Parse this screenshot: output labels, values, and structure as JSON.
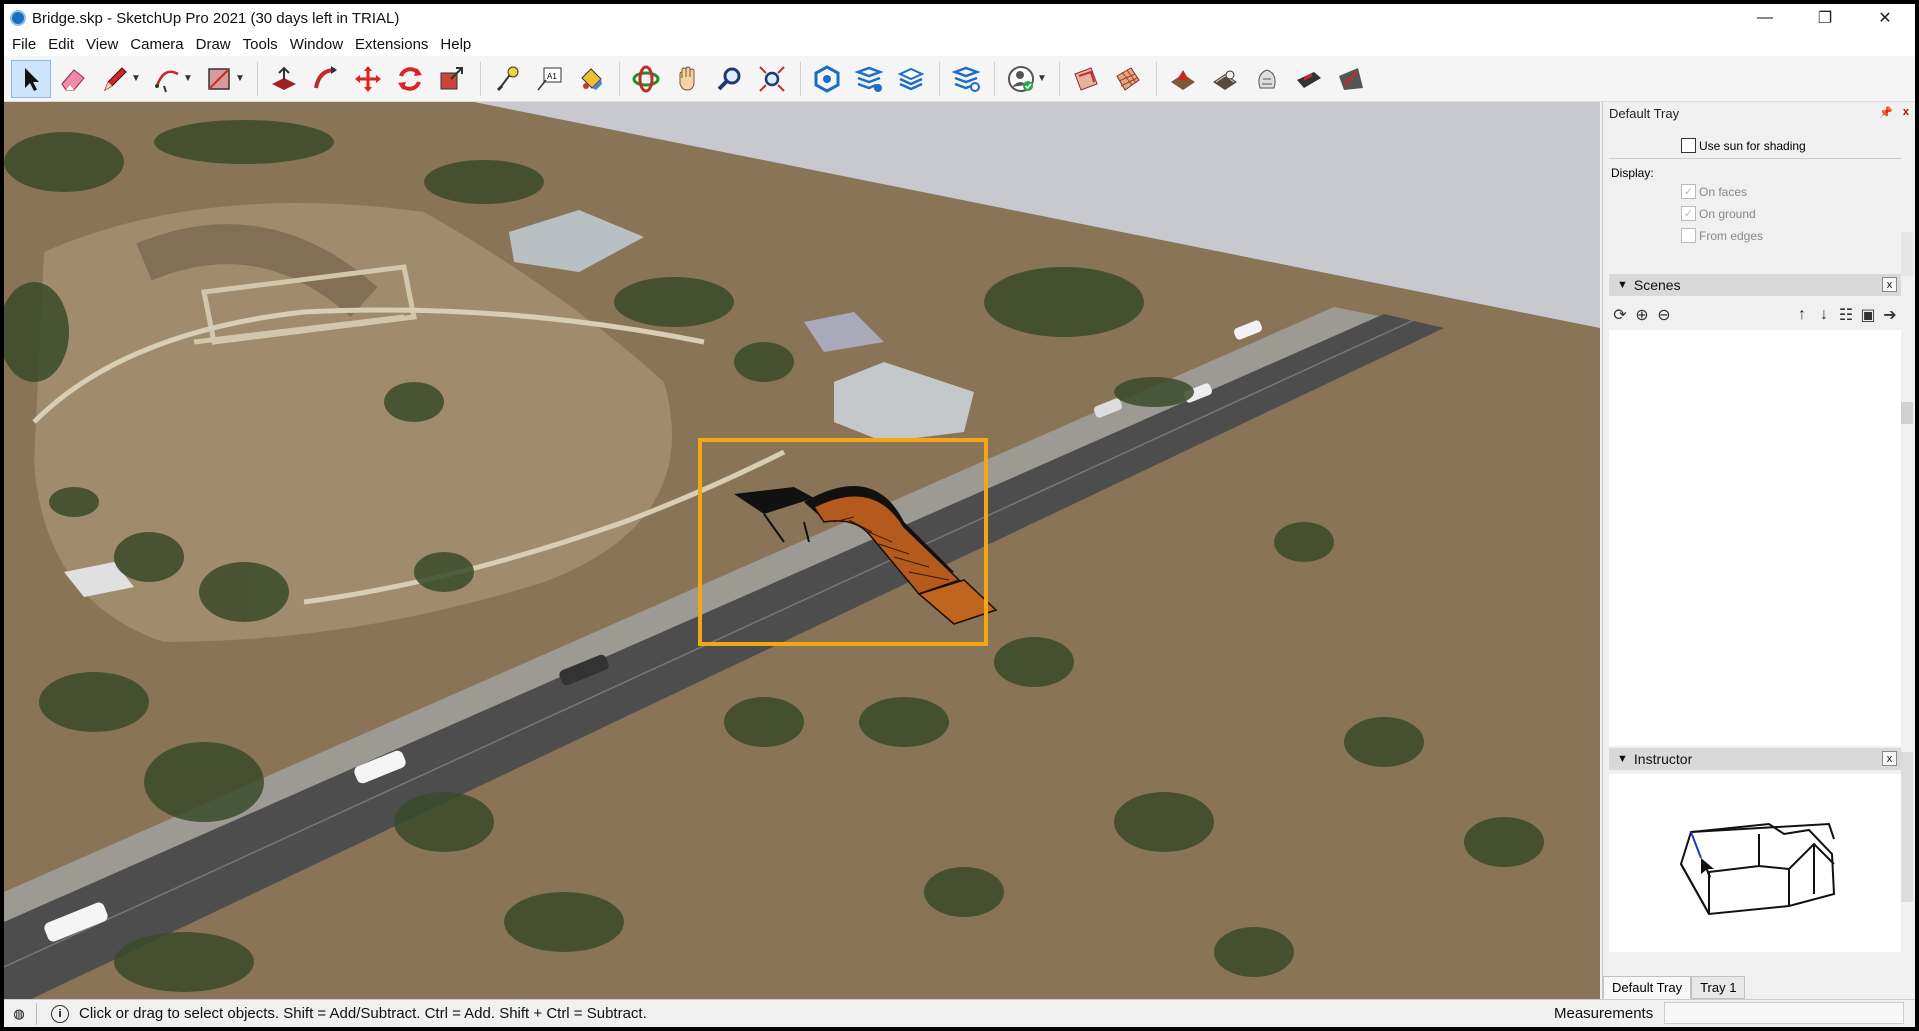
{
  "window": {
    "title": "Bridge.skp - SketchUp Pro 2021 (30 days left in TRIAL)",
    "minimize": "—",
    "restore": "❐",
    "close": "✕"
  },
  "menu": [
    "File",
    "Edit",
    "View",
    "Camera",
    "Draw",
    "Tools",
    "Window",
    "Extensions",
    "Help"
  ],
  "tray": {
    "title": "Default Tray",
    "pin": "📌",
    "close": "x",
    "shadows": {
      "use_sun_label": "Use sun for shading",
      "use_sun_checked": false,
      "display_label": "Display:",
      "on_faces_label": "On faces",
      "on_ground_label": "On ground",
      "from_edges_label": "From edges"
    },
    "scenes": {
      "title": "Scenes",
      "close": "x"
    },
    "instructor": {
      "title": "Instructor",
      "close": "x"
    },
    "tabs": [
      "Default Tray",
      "Tray 1"
    ]
  },
  "status": {
    "info_icon": "i",
    "hint": "Click or drag to select objects. Shift = Add/Subtract. Ctrl = Add. Shift + Ctrl = Subtract.",
    "measurements_label": "Measurements",
    "measurements_value": ""
  },
  "colors": {
    "selection_box": "#f5a614",
    "bridge_wood": "#b45a1c",
    "ground": "#8a7457",
    "road": "#4d4d4d",
    "sky": "#c8c8cf"
  }
}
